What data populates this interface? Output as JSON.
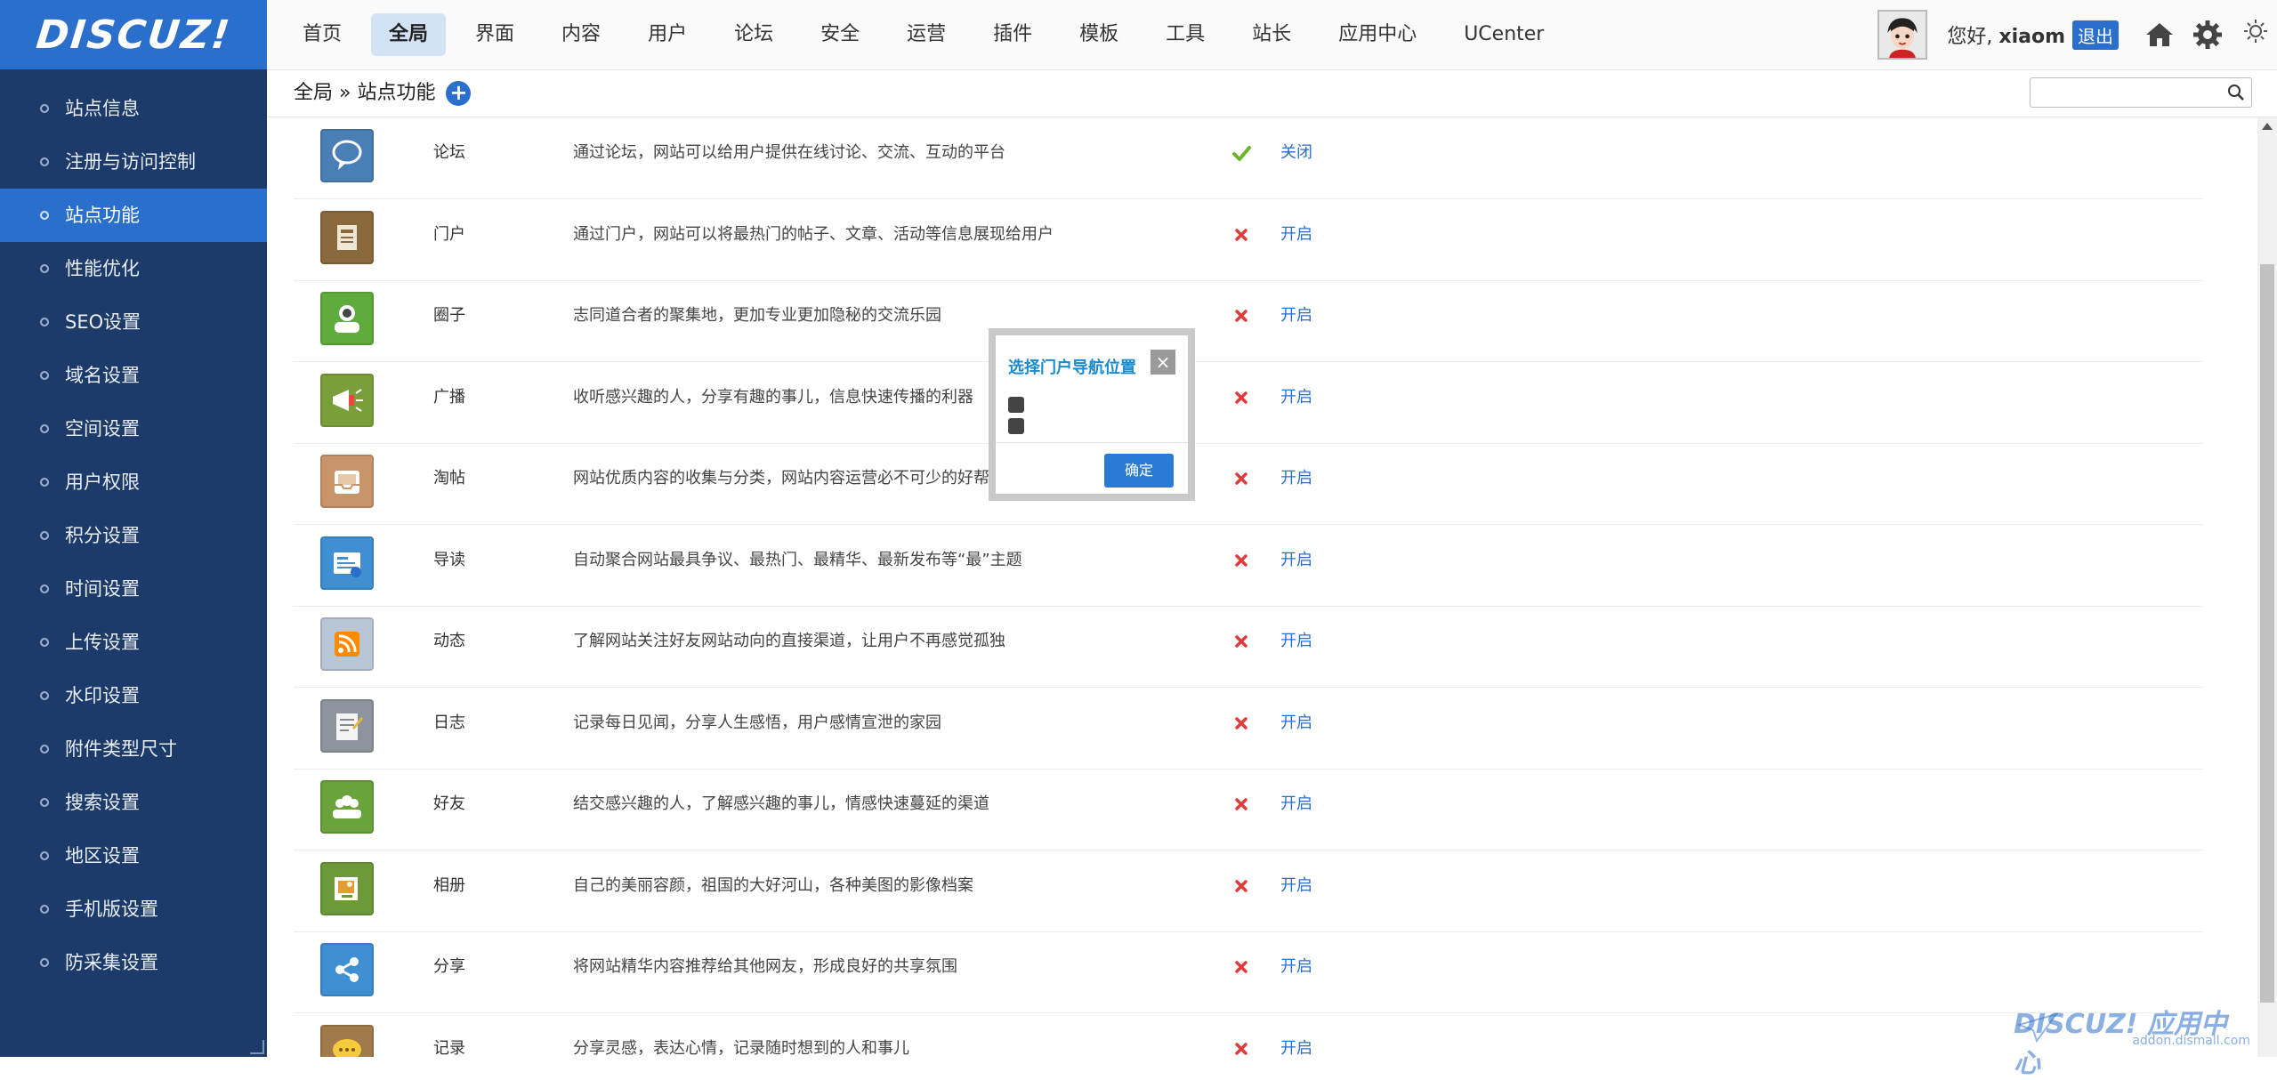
{
  "logo": {
    "text": "DISCUZ!"
  },
  "topnav": {
    "items": [
      {
        "label": "首页",
        "active": false
      },
      {
        "label": "全局",
        "active": true
      },
      {
        "label": "界面",
        "active": false
      },
      {
        "label": "内容",
        "active": false
      },
      {
        "label": "用户",
        "active": false
      },
      {
        "label": "论坛",
        "active": false
      },
      {
        "label": "安全",
        "active": false
      },
      {
        "label": "运营",
        "active": false
      },
      {
        "label": "插件",
        "active": false
      },
      {
        "label": "模板",
        "active": false
      },
      {
        "label": "工具",
        "active": false
      },
      {
        "label": "站长",
        "active": false
      },
      {
        "label": "应用中心",
        "active": false
      },
      {
        "label": "UCenter",
        "active": false
      }
    ]
  },
  "user": {
    "greeting": "您好, ",
    "name": "xiaom",
    "logout": "退出"
  },
  "sidebar": {
    "items": [
      {
        "label": "站点信息",
        "active": false
      },
      {
        "label": "注册与访问控制",
        "active": false
      },
      {
        "label": "站点功能",
        "active": true
      },
      {
        "label": "性能优化",
        "active": false
      },
      {
        "label": "SEO设置",
        "active": false
      },
      {
        "label": "域名设置",
        "active": false
      },
      {
        "label": "空间设置",
        "active": false
      },
      {
        "label": "用户权限",
        "active": false
      },
      {
        "label": "积分设置",
        "active": false
      },
      {
        "label": "时间设置",
        "active": false
      },
      {
        "label": "上传设置",
        "active": false
      },
      {
        "label": "水印设置",
        "active": false
      },
      {
        "label": "附件类型尺寸",
        "active": false
      },
      {
        "label": "搜索设置",
        "active": false
      },
      {
        "label": "地区设置",
        "active": false
      },
      {
        "label": "手机版设置",
        "active": false
      },
      {
        "label": "防采集设置",
        "active": false
      }
    ]
  },
  "breadcrumb": {
    "root": "全局",
    "sep": " » ",
    "current": "站点功能",
    "add": "+"
  },
  "search": {
    "value": "",
    "placeholder": ""
  },
  "features": [
    {
      "name": "论坛",
      "desc": "通过论坛，网站可以给用户提供在线讨论、交流、互动的平台",
      "enabled": true,
      "action": "关闭",
      "color": "#4a7fb5",
      "icon": "speech-bubble-icon"
    },
    {
      "name": "门户",
      "desc": "通过门户，网站可以将最热门的帖子、文章、活动等信息展现给用户",
      "enabled": false,
      "action": "开启",
      "color": "#8a6a3c",
      "icon": "newspaper-icon"
    },
    {
      "name": "圈子",
      "desc": "志同道合者的聚集地，更加专业更加隐秘的交流乐园",
      "enabled": false,
      "action": "开启",
      "color": "#5fab3b",
      "icon": "group-icon"
    },
    {
      "name": "广播",
      "desc": "收听感兴趣的人，分享有趣的事儿，信息快速传播的利器",
      "enabled": false,
      "action": "开启",
      "color": "#7a9f3a",
      "icon": "megaphone-icon"
    },
    {
      "name": "淘帖",
      "desc": "网站优质内容的收集与分类，网站内容运营必不可少的好帮手",
      "enabled": false,
      "action": "开启",
      "color": "#c8946a",
      "icon": "tray-icon"
    },
    {
      "name": "导读",
      "desc": "自动聚合网站最具争议、最热门、最精华、最新发布等“最”主题",
      "enabled": false,
      "action": "开启",
      "color": "#3f8fd2",
      "icon": "guide-icon"
    },
    {
      "name": "动态",
      "desc": "了解网站关注好友网站动向的直接渠道，让用户不再感觉孤独",
      "enabled": false,
      "action": "开启",
      "color": "#b9c6d6",
      "icon": "rss-icon"
    },
    {
      "name": "日志",
      "desc": "记录每日见闻，分享人生感悟，用户感情宣泄的家园",
      "enabled": false,
      "action": "开启",
      "color": "#8d949c",
      "icon": "notepad-icon"
    },
    {
      "name": "好友",
      "desc": "结交感兴趣的人，了解感兴趣的事儿，情感快速蔓延的渠道",
      "enabled": false,
      "action": "开启",
      "color": "#6aa23c",
      "icon": "friends-icon"
    },
    {
      "name": "相册",
      "desc": "自己的美丽容颜，祖国的大好河山，各种美图的影像档案",
      "enabled": false,
      "action": "开启",
      "color": "#6c9a3a",
      "icon": "photo-album-icon"
    },
    {
      "name": "分享",
      "desc": "将网站精华内容推荐给其他网友，形成良好的共享氛围",
      "enabled": false,
      "action": "开启",
      "color": "#3f8fd2",
      "icon": "share-icon"
    },
    {
      "name": "记录",
      "desc": "分享灵感，表达心情，记录随时想到的人和事儿",
      "enabled": false,
      "action": "开启",
      "color": "#a07a4a",
      "icon": "chat-bubble-icon"
    }
  ],
  "dialog": {
    "title": "选择门户导航位置",
    "close": "×",
    "ok": "确定"
  },
  "watermark": {
    "brand": "DISCUZ! 应用中心",
    "url": "addon.dismall.com"
  },
  "colors": {
    "accent": "#2b6fcd",
    "sidebar_bg": "#1c3b6b",
    "enabled": "#6ab42a",
    "disabled": "#e03b3b"
  }
}
